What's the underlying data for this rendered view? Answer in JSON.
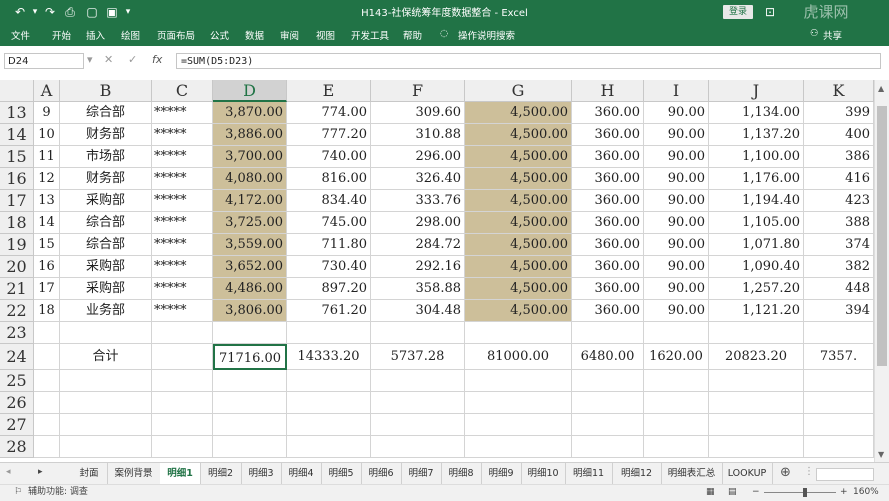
{
  "window": {
    "title": "H143-社保统筹年度数据整合 - Excel",
    "login_label": "登录",
    "share_label": "共享",
    "watermark": "虎课网"
  },
  "ribbon": {
    "tabs": [
      "文件",
      "开始",
      "插入",
      "绘图",
      "页面布局",
      "公式",
      "数据",
      "审阅",
      "视图",
      "开发工具",
      "帮助"
    ],
    "tell_me": "操作说明搜索"
  },
  "formula_bar": {
    "name_box": "D24",
    "formula": "=SUM(D5:D23)"
  },
  "columns": [
    "A",
    "B",
    "C",
    "D",
    "E",
    "F",
    "G",
    "H",
    "I",
    "J",
    "K"
  ],
  "rows": [
    {
      "num": "13",
      "a": "9",
      "b": "综合部",
      "c": "*****",
      "d": "3,870.00",
      "e": "774.00",
      "f": "309.60",
      "g": "4,500.00",
      "h": "360.00",
      "i": "90.00",
      "j": "1,134.00",
      "k": "399"
    },
    {
      "num": "14",
      "a": "10",
      "b": "财务部",
      "c": "*****",
      "d": "3,886.00",
      "e": "777.20",
      "f": "310.88",
      "g": "4,500.00",
      "h": "360.00",
      "i": "90.00",
      "j": "1,137.20",
      "k": "400"
    },
    {
      "num": "15",
      "a": "11",
      "b": "市场部",
      "c": "*****",
      "d": "3,700.00",
      "e": "740.00",
      "f": "296.00",
      "g": "4,500.00",
      "h": "360.00",
      "i": "90.00",
      "j": "1,100.00",
      "k": "386"
    },
    {
      "num": "16",
      "a": "12",
      "b": "财务部",
      "c": "*****",
      "d": "4,080.00",
      "e": "816.00",
      "f": "326.40",
      "g": "4,500.00",
      "h": "360.00",
      "i": "90.00",
      "j": "1,176.00",
      "k": "416"
    },
    {
      "num": "17",
      "a": "13",
      "b": "采购部",
      "c": "*****",
      "d": "4,172.00",
      "e": "834.40",
      "f": "333.76",
      "g": "4,500.00",
      "h": "360.00",
      "i": "90.00",
      "j": "1,194.40",
      "k": "423"
    },
    {
      "num": "18",
      "a": "14",
      "b": "综合部",
      "c": "*****",
      "d": "3,725.00",
      "e": "745.00",
      "f": "298.00",
      "g": "4,500.00",
      "h": "360.00",
      "i": "90.00",
      "j": "1,105.00",
      "k": "388"
    },
    {
      "num": "19",
      "a": "15",
      "b": "综合部",
      "c": "*****",
      "d": "3,559.00",
      "e": "711.80",
      "f": "284.72",
      "g": "4,500.00",
      "h": "360.00",
      "i": "90.00",
      "j": "1,071.80",
      "k": "374"
    },
    {
      "num": "20",
      "a": "16",
      "b": "采购部",
      "c": "*****",
      "d": "3,652.00",
      "e": "730.40",
      "f": "292.16",
      "g": "4,500.00",
      "h": "360.00",
      "i": "90.00",
      "j": "1,090.40",
      "k": "382"
    },
    {
      "num": "21",
      "a": "17",
      "b": "采购部",
      "c": "*****",
      "d": "4,486.00",
      "e": "897.20",
      "f": "358.88",
      "g": "4,500.00",
      "h": "360.00",
      "i": "90.00",
      "j": "1,257.20",
      "k": "448"
    },
    {
      "num": "22",
      "a": "18",
      "b": "业务部",
      "c": "*****",
      "d": "3,806.00",
      "e": "761.20",
      "f": "304.48",
      "g": "4,500.00",
      "h": "360.00",
      "i": "90.00",
      "j": "1,121.20",
      "k": "394"
    },
    {
      "num": "23",
      "a": "",
      "b": "",
      "c": "",
      "d": "",
      "e": "",
      "f": "",
      "g": "",
      "h": "",
      "i": "",
      "j": "",
      "k": ""
    },
    {
      "num": "24",
      "a": "",
      "b": "合计",
      "c": "",
      "d": "71716.00",
      "e": "14333.20",
      "f": "5737.28",
      "g": "81000.00",
      "h": "6480.00",
      "i": "1620.00",
      "j": "20823.20",
      "k": "7357."
    }
  ],
  "empty_rows": [
    "25",
    "26",
    "27",
    "28"
  ],
  "sheet_tabs": [
    "封面",
    "案例背景",
    "明细1",
    "明细2",
    "明细3",
    "明细4",
    "明细5",
    "明细6",
    "明细7",
    "明细8",
    "明细9",
    "明细10",
    "明细11",
    "明细12",
    "明细表汇总",
    "LOOKUP"
  ],
  "active_tab": "明细1",
  "status": {
    "accessibility": "辅助功能: 调查",
    "zoom": "160%"
  },
  "colors": {
    "excel_green": "#217346",
    "highlight_fill": "#cdbf9a",
    "header_fill": "#efefef",
    "grid_line": "#d4d4d4"
  }
}
